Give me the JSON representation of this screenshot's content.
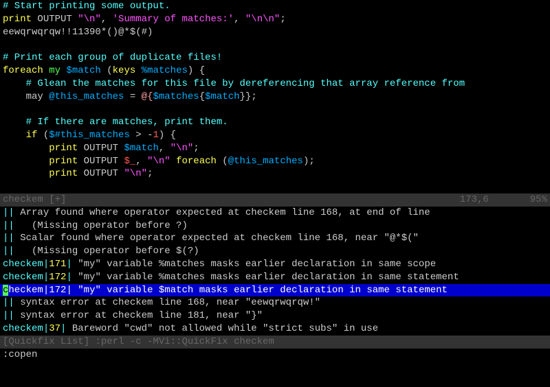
{
  "code": {
    "l01_comment": "# Start printing some output.",
    "l02_print": "print",
    "l02_output": " OUTPUT ",
    "l02_str1": "\"\\n\"",
    "l02_mid": ", ",
    "l02_str2": "'Summary of matches:'",
    "l02_mid2": ", ",
    "l02_str3": "\"\\n\\n\"",
    "l02_end": ";",
    "l03": "eewqrwqrqw!!11390*()@*$(#)",
    "l04": "",
    "l05_comment": "# Print each group of duplicate files!",
    "l06_foreach": "foreach",
    "l06_my": " my ",
    "l06_var": "$match",
    "l06_open": " (",
    "l06_keys": "keys",
    "l06_space": " ",
    "l06_hash": "%matches",
    "l06_close": ") {",
    "l07_comment": "    # Glean the matches for this file by dereferencing that array reference from",
    "l08_pre": "    ",
    "l08_may": "may",
    "l08_sp": " ",
    "l08_var": "@this_matches",
    "l08_eq": " = ",
    "l08_deref1": "@{",
    "l08_deref2": "$matches",
    "l08_deref3": "{",
    "l08_deref4": "$match",
    "l08_deref5": "}}",
    "l08_end": ";",
    "l09": "",
    "l10_comment": "    # If there are matches, print them.",
    "l11_pre": "    ",
    "l11_if": "if",
    "l11_open": " (",
    "l11_var": "$#this_matches",
    "l11_op": " > -",
    "l11_num": "1",
    "l11_close": ") {",
    "l12_pre": "        ",
    "l12_print": "print",
    "l12_output": " OUTPUT ",
    "l12_var": "$match",
    "l12_mid": ", ",
    "l12_str": "\"\\n\"",
    "l12_end": ";",
    "l13_pre": "        ",
    "l13_print": "print",
    "l13_output": " OUTPUT ",
    "l13_var": "$_",
    "l13_mid": ", ",
    "l13_str": "\"\\n\"",
    "l13_sp": " ",
    "l13_foreach": "foreach",
    "l13_open": " (",
    "l13_arr": "@this_matches",
    "l13_close": ");",
    "l14_pre": "        ",
    "l14_print": "print",
    "l14_output": " OUTPUT ",
    "l14_str": "\"\\n\"",
    "l14_end": ";"
  },
  "status1": {
    "left": "checkem [+]",
    "mid": "173,6",
    "right": "95%"
  },
  "quickfix": {
    "lines": [
      {
        "file": "",
        "sep": "||",
        "lnum": "",
        "msg": " Array found where operator expected at checkem line 168, at end of line"
      },
      {
        "file": "",
        "sep": "||",
        "lnum": "",
        "msg": "   (Missing operator before ?)"
      },
      {
        "file": "",
        "sep": "||",
        "lnum": "",
        "msg": " Scalar found where operator expected at checkem line 168, near \"@*$(\""
      },
      {
        "file": "",
        "sep": "||",
        "lnum": "",
        "msg": "   (Missing operator before $(?)"
      },
      {
        "file": "checkem",
        "sep": "|",
        "lnum": "171",
        "msg": " \"my\" variable %matches masks earlier declaration in same scope"
      },
      {
        "file": "checkem",
        "sep": "|",
        "lnum": "172",
        "msg": " \"my\" variable %matches masks earlier declaration in same statement"
      },
      {
        "file": "checkem",
        "sep": "|",
        "lnum": "172",
        "msg": " \"my\" variable $match masks earlier declaration in same statement",
        "selected": true
      },
      {
        "file": "",
        "sep": "||",
        "lnum": "",
        "msg": " syntax error at checkem line 168, near \"eewqrwqrqw!\""
      },
      {
        "file": "",
        "sep": "||",
        "lnum": "",
        "msg": " syntax error at checkem line 181, near \"}\""
      },
      {
        "file": "checkem",
        "sep": "|",
        "lnum": "37",
        "msg": " Bareword \"cwd\" not allowed while \"strict subs\" in use"
      }
    ]
  },
  "status2": "[Quickfix List] :perl -c -MVi::QuickFix checkem",
  "cmdline": ":copen"
}
